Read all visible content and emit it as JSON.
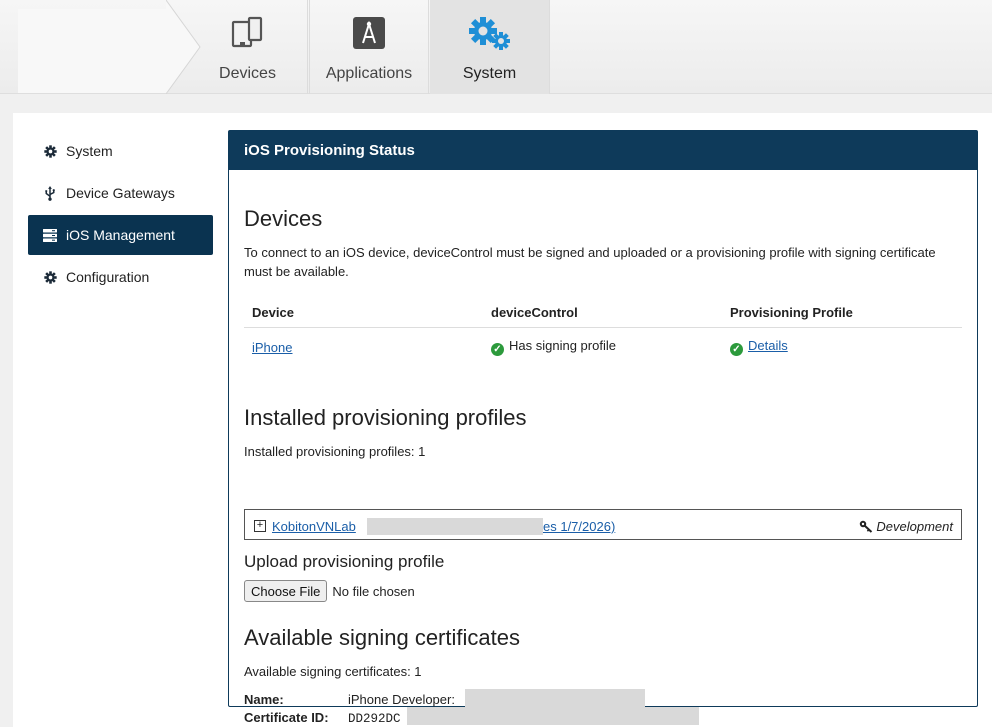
{
  "top_nav": {
    "tabs": [
      {
        "label": "Devices",
        "icon": "devices-icon"
      },
      {
        "label": "Applications",
        "icon": "applications-icon"
      },
      {
        "label": "System",
        "icon": "gears-icon",
        "active": true
      }
    ],
    "accent_color": "#1f8fd6"
  },
  "sidebar": {
    "items": [
      {
        "label": "System",
        "icon": "gear-icon"
      },
      {
        "label": "Device Gateways",
        "icon": "usb-icon"
      },
      {
        "label": "iOS Management",
        "icon": "server-icon",
        "active": true
      },
      {
        "label": "Configuration",
        "icon": "gear-icon"
      }
    ],
    "active_color": "#0a3350"
  },
  "card": {
    "title": "iOS Provisioning Status",
    "header_color": "#0e3a5a"
  },
  "devices": {
    "heading": "Devices",
    "description": "To connect to an iOS device, deviceControl must be signed and uploaded or a provisioning profile with signing certificate must be available.",
    "columns": [
      "Device",
      "deviceControl",
      "Provisioning Profile"
    ],
    "rows": [
      {
        "device": "iPhone",
        "device_control": "Has signing profile",
        "provisioning_profile": "Details"
      }
    ]
  },
  "installed_profiles": {
    "heading": "Installed provisioning profiles",
    "count_text": "Installed provisioning profiles: 1",
    "profiles": [
      {
        "name_visible": "KobitonVNLab",
        "tail_visible": "es 1/7/2026)",
        "type": "Development"
      }
    ]
  },
  "upload": {
    "heading": "Upload provisioning profile",
    "button_label": "Choose File",
    "status": "No file chosen"
  },
  "certificates": {
    "heading": "Available signing certificates",
    "count_text": "Available signing certificates: 1",
    "name_label": "Name:",
    "name_value": "iPhone Developer:",
    "id_label": "Certificate ID:",
    "id_value": "DD292DC"
  }
}
